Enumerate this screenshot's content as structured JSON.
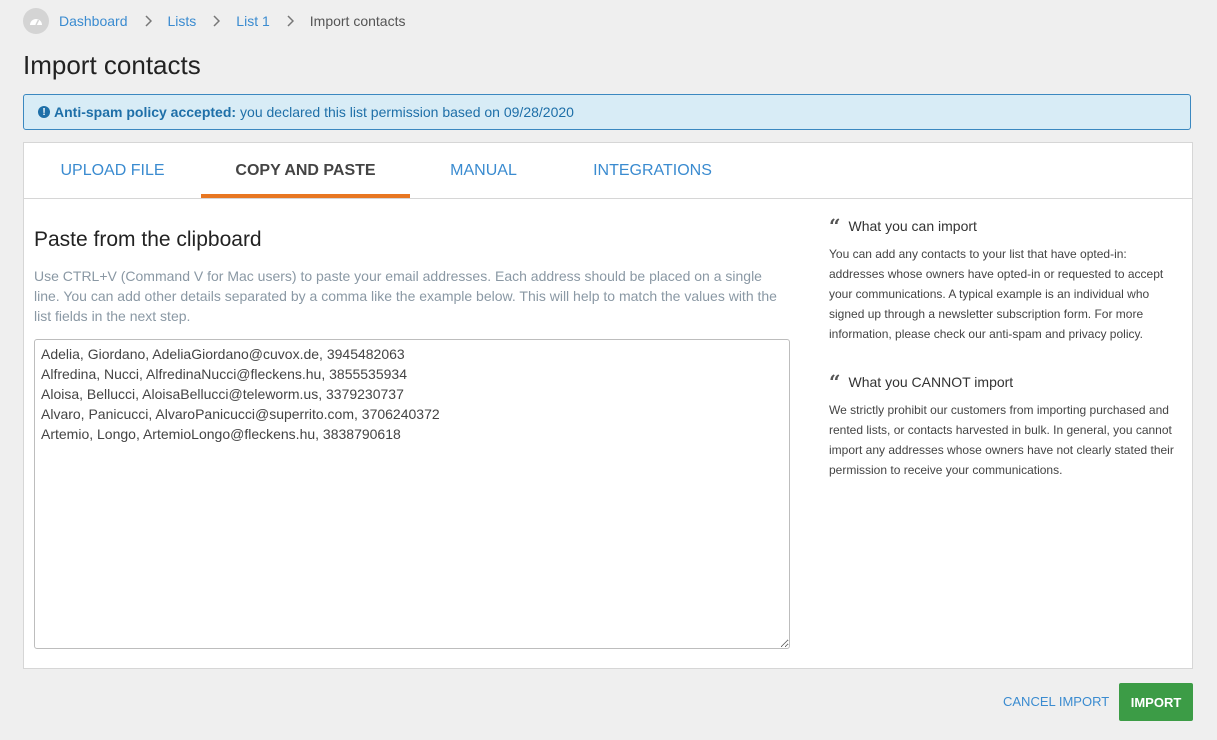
{
  "breadcrumb": {
    "home_icon": "dashboard-gauge-icon",
    "items": [
      {
        "label": "Dashboard"
      },
      {
        "label": "Lists"
      },
      {
        "label": "List 1"
      }
    ],
    "current": "Import contacts"
  },
  "page": {
    "title": "Import contacts"
  },
  "alert": {
    "icon": "info-circle-icon",
    "strong": "Anti-spam policy accepted:",
    "text": "you declared this list permission based on 09/28/2020"
  },
  "tabs": [
    {
      "label": "Upload file",
      "active": false
    },
    {
      "label": "Copy and paste",
      "active": true
    },
    {
      "label": "Manual",
      "active": false
    },
    {
      "label": "Integrations",
      "active": false
    }
  ],
  "paste": {
    "title": "Paste from the clipboard",
    "help": "Use CTRL+V (Command V for Mac users) to paste your email addresses. Each address should be placed on a single line. You can add other details separated by a comma like the example below. This will help to match the values with the list fields in the next step.",
    "value": "Adelia, Giordano, AdeliaGiordano@cuvox.de, 3945482063\nAlfredina, Nucci, AlfredinaNucci@fleckens.hu, 3855535934\nAloisa, Bellucci, AloisaBellucci@teleworm.us, 3379230737\nAlvaro, Panicucci, AlvaroPanicucci@superrito.com, 3706240372\nArtemio, Longo, ArtemioLongo@fleckens.hu, 3838790618"
  },
  "info": {
    "can": {
      "icon": "quote-icon",
      "title": "What you can import",
      "text": "You can add any contacts to your list that have opted-in: addresses whose owners have opted-in or requested to accept your communications. A typical example is an individual who signed up through a newsletter subscription form. For more information, please check our anti-spam and privacy policy."
    },
    "cannot": {
      "icon": "quote-icon",
      "title": "What you CANNOT import",
      "text": "We strictly prohibit our customers from importing purchased and rented lists, or contacts harvested in bulk. In general, you cannot import any addresses whose owners have not clearly stated their permission to receive your communications."
    }
  },
  "actions": {
    "cancel_label": "Cancel import",
    "import_label": "Import"
  },
  "colors": {
    "link": "#3a8bd0",
    "accent_tab": "#e87722",
    "alert_bg": "#d8ecf6",
    "alert_text": "#1e6fa8",
    "import_button": "#3c9c46"
  }
}
